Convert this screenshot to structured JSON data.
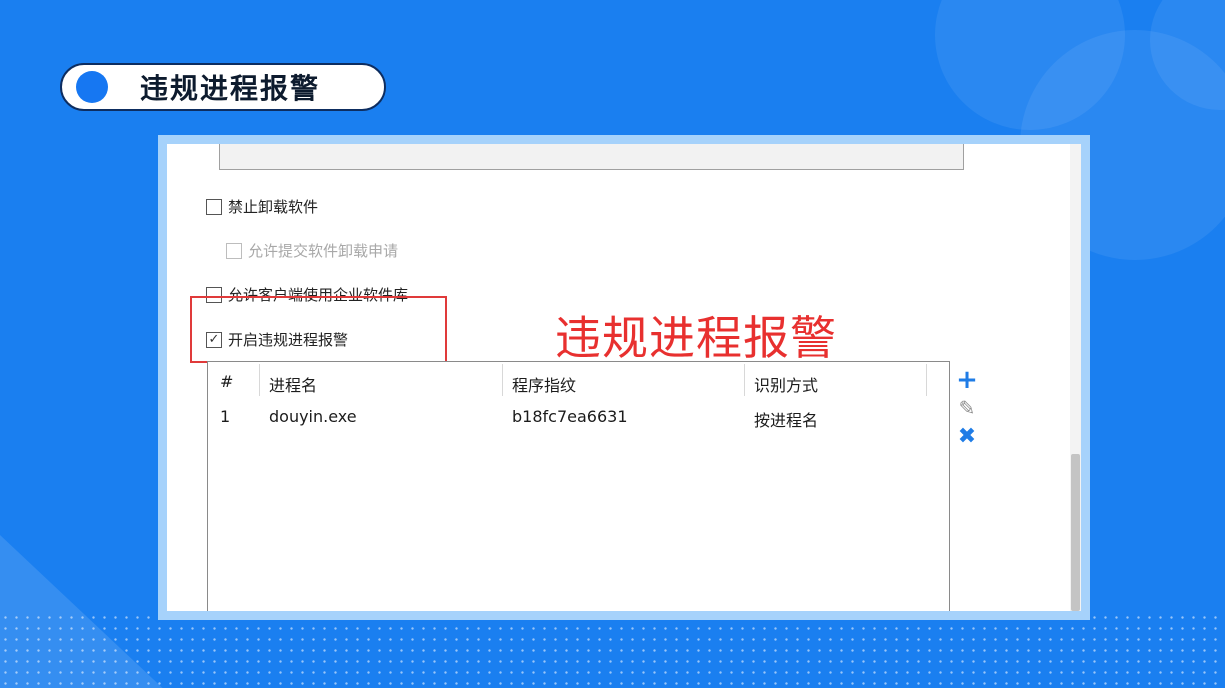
{
  "slide_title": "违规进程报警",
  "annotation": "违规进程报警",
  "options": [
    {
      "label": "禁止卸载软件",
      "checked": false,
      "disabled": false
    },
    {
      "label": "允许提交软件卸载申请",
      "checked": false,
      "disabled": true
    },
    {
      "label": "允许客户端使用企业软件库",
      "checked": false,
      "disabled": false
    },
    {
      "label": "开启违规进程报警",
      "checked": true,
      "disabled": false
    }
  ],
  "check_mark": "✓",
  "table": {
    "headers": [
      "#",
      "进程名",
      "程序指纹",
      "识别方式"
    ],
    "rows": [
      [
        "1",
        "douyin.exe",
        "b18fc7ea6631",
        "按进程名"
      ]
    ]
  },
  "icons": {
    "add": "plus-icon",
    "edit": "pencil-icon",
    "delete": "close-icon"
  },
  "colors": {
    "background": "#1a7ff0",
    "accent": "#1f7ce6",
    "highlight": "#e03a3a"
  }
}
